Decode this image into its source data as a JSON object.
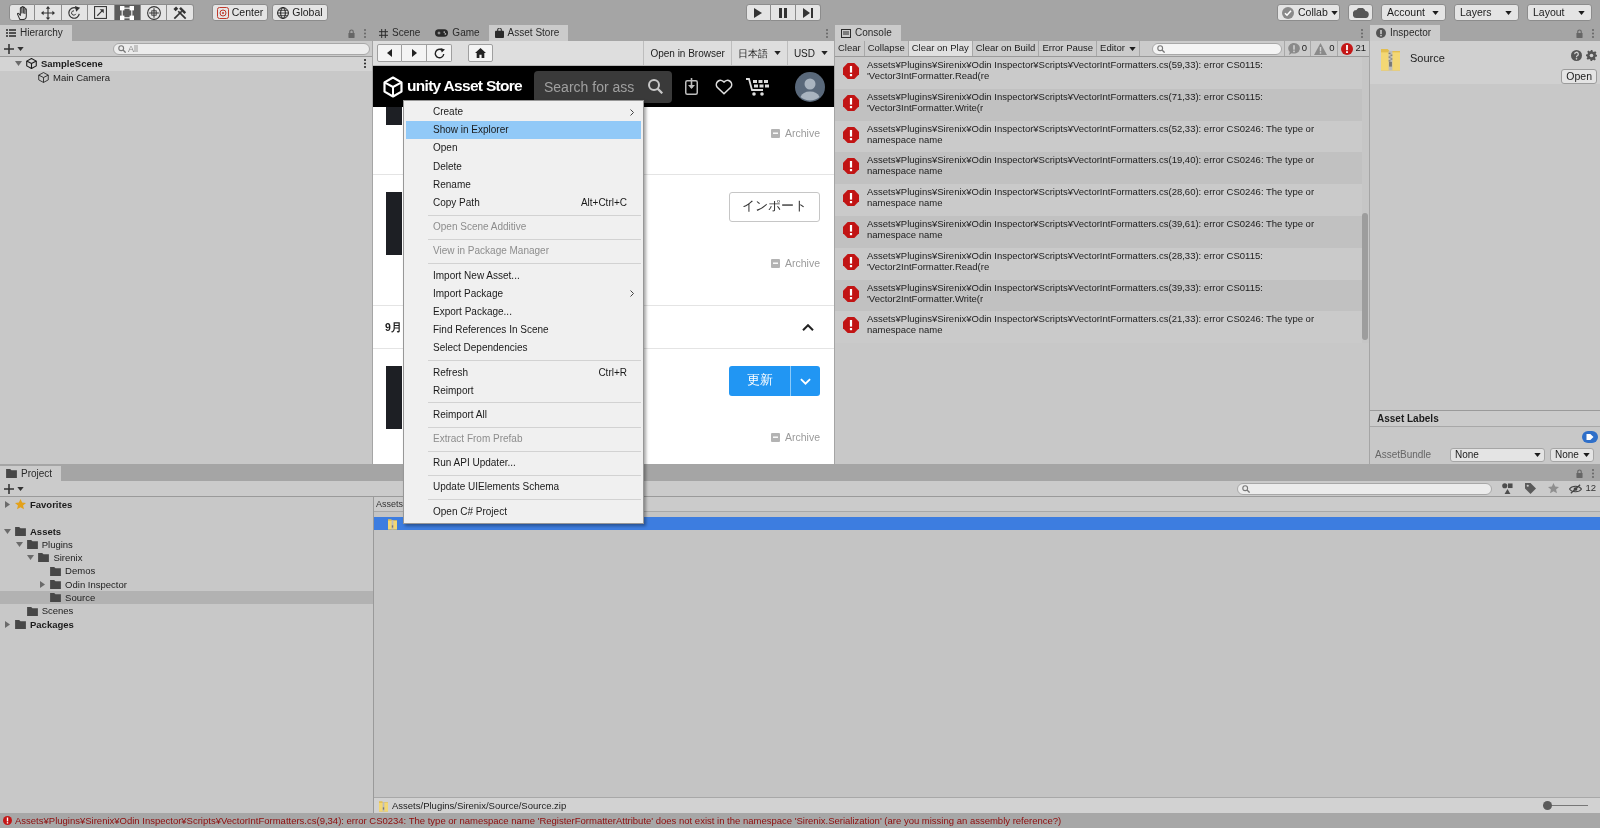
{
  "toolbar": {
    "tools": [
      {
        "selected": false
      },
      {
        "selected": false
      },
      {
        "selected": false
      },
      {
        "selected": false
      },
      {
        "selected": true
      },
      {
        "selected": false
      },
      {
        "selected": false
      }
    ],
    "pivot_buttons": [
      "Center",
      "Global"
    ],
    "collab": "Collab",
    "menus": [
      "Account",
      "Layers",
      "Layout"
    ]
  },
  "hierarchy": {
    "title": "Hierarchy",
    "search": {
      "placeholder": "All"
    },
    "items": [
      {
        "label": "SampleScene",
        "kind": "scene",
        "expanded": true,
        "selected": false,
        "children": [
          {
            "label": "Main Camera",
            "kind": "gameobject",
            "selected": false
          }
        ]
      }
    ]
  },
  "center_panel": {
    "tabs": [
      {
        "label": "Scene",
        "selected": false
      },
      {
        "label": "Game",
        "selected": false
      },
      {
        "label": "Asset Store",
        "selected": true
      }
    ],
    "browser": {
      "open_in_browser": "Open in Browser",
      "language": "日本語",
      "currency": "USD"
    },
    "store": {
      "logo": "unity Asset Store",
      "search": {
        "placeholder": "Search for ass"
      },
      "list": [
        {
          "kind": "item",
          "archive": "Archive"
        },
        {
          "kind": "item",
          "button": {
            "kind": "outline",
            "label": "インポート"
          },
          "archive": "Archive"
        },
        {
          "kind": "section",
          "title": "9月",
          "expanded": true
        },
        {
          "kind": "item",
          "button": {
            "kind": "split",
            "label": "更新"
          },
          "archive": "Archive"
        }
      ]
    }
  },
  "console": {
    "title": "Console",
    "buttons": [
      {
        "label": "Clear",
        "kind": "action"
      },
      {
        "label": "Collapse",
        "kind": "toggle",
        "on": false
      },
      {
        "label": "Clear on Play",
        "kind": "toggle",
        "on": true
      },
      {
        "label": "Clear on Build",
        "kind": "toggle",
        "on": false
      },
      {
        "label": "Error Pause",
        "kind": "toggle",
        "on": false
      }
    ],
    "editor_menu": "Editor",
    "counts": [
      {
        "kind": "info",
        "count": "0"
      },
      {
        "kind": "warning",
        "count": "0"
      },
      {
        "kind": "error",
        "count": "21"
      }
    ],
    "messages": [
      "Assets¥Plugins¥Sirenix¥Odin Inspector¥Scripts¥VectorIntFormatters.cs(59,33): error CS0115: 'Vector3IntFormatter.Read(re",
      "Assets¥Plugins¥Sirenix¥Odin Inspector¥Scripts¥VectorIntFormatters.cs(71,33): error CS0115: 'Vector3IntFormatter.Write(r",
      "Assets¥Plugins¥Sirenix¥Odin Inspector¥Scripts¥VectorIntFormatters.cs(52,33): error CS0246: The type or namespace name",
      "Assets¥Plugins¥Sirenix¥Odin Inspector¥Scripts¥VectorIntFormatters.cs(19,40): error CS0246: The type or namespace name",
      "Assets¥Plugins¥Sirenix¥Odin Inspector¥Scripts¥VectorIntFormatters.cs(28,60): error CS0246: The type or namespace name",
      "Assets¥Plugins¥Sirenix¥Odin Inspector¥Scripts¥VectorIntFormatters.cs(39,61): error CS0246: The type or namespace name",
      "Assets¥Plugins¥Sirenix¥Odin Inspector¥Scripts¥VectorIntFormatters.cs(28,33): error CS0115: 'Vector2IntFormatter.Read(re",
      "Assets¥Plugins¥Sirenix¥Odin Inspector¥Scripts¥VectorIntFormatters.cs(39,33): error CS0115: 'Vector2IntFormatter.Write(r",
      "Assets¥Plugins¥Sirenix¥Odin Inspector¥Scripts¥VectorIntFormatters.cs(21,33): error CS0246: The type or namespace name"
    ]
  },
  "inspector": {
    "title": "Inspector",
    "asset": {
      "name": "Source",
      "button": "Open"
    },
    "labels": {
      "title": "Asset Labels",
      "field": "AssetBundle",
      "bundle": "None",
      "variant": "None"
    }
  },
  "project": {
    "title": "Project",
    "tree": [
      {
        "label": "Favorites",
        "kind": "favorites",
        "expanded": false,
        "selected": false
      },
      {
        "label": "Assets",
        "kind": "folder",
        "expanded": true,
        "selected": false,
        "children": [
          {
            "label": "Plugins",
            "kind": "folder",
            "expanded": true,
            "selected": false,
            "children": [
              {
                "label": "Sirenix",
                "kind": "folder",
                "expanded": true,
                "selected": false,
                "children": [
                  {
                    "label": "Demos",
                    "kind": "folder",
                    "selected": false
                  },
                  {
                    "label": "Odin Inspector",
                    "kind": "folder",
                    "expanded": false,
                    "selected": false
                  },
                  {
                    "label": "Source",
                    "kind": "folder",
                    "selected": true
                  }
                ]
              }
            ]
          },
          {
            "label": "Scenes",
            "kind": "folder",
            "selected": false
          }
        ]
      },
      {
        "label": "Packages",
        "kind": "folder",
        "expanded": false,
        "selected": false
      }
    ],
    "breadcrumb": "Assets",
    "files": [
      {
        "selected": true
      }
    ],
    "hidden_count": "12",
    "path": "Assets/Plugins/Sirenix/Source/Source.zip",
    "zoom_slider": {
      "level": 0
    }
  },
  "context_menu": {
    "items": [
      {
        "kind": "item",
        "label": "Create",
        "submenu": true,
        "disabled": false,
        "selected": false
      },
      {
        "kind": "item",
        "label": "Show in Explorer",
        "submenu": false,
        "disabled": false,
        "selected": true
      },
      {
        "kind": "item",
        "label": "Open",
        "submenu": false,
        "disabled": false,
        "selected": false
      },
      {
        "kind": "item",
        "label": "Delete",
        "submenu": false,
        "disabled": false,
        "selected": false
      },
      {
        "kind": "item",
        "label": "Rename",
        "submenu": false,
        "disabled": false,
        "selected": false
      },
      {
        "kind": "item",
        "label": "Copy Path",
        "shortcut": "Alt+Ctrl+C",
        "submenu": false,
        "disabled": false,
        "selected": false
      },
      {
        "kind": "separator"
      },
      {
        "kind": "item",
        "label": "Open Scene Additive",
        "submenu": false,
        "disabled": true,
        "selected": false
      },
      {
        "kind": "separator"
      },
      {
        "kind": "item",
        "label": "View in Package Manager",
        "submenu": false,
        "disabled": true,
        "selected": false
      },
      {
        "kind": "separator"
      },
      {
        "kind": "item",
        "label": "Import New Asset...",
        "submenu": false,
        "disabled": false,
        "selected": false
      },
      {
        "kind": "item",
        "label": "Import Package",
        "submenu": true,
        "disabled": false,
        "selected": false
      },
      {
        "kind": "item",
        "label": "Export Package...",
        "submenu": false,
        "disabled": false,
        "selected": false
      },
      {
        "kind": "item",
        "label": "Find References In Scene",
        "submenu": false,
        "disabled": false,
        "selected": false
      },
      {
        "kind": "item",
        "label": "Select Dependencies",
        "submenu": false,
        "disabled": false,
        "selected": false
      },
      {
        "kind": "separator"
      },
      {
        "kind": "item",
        "label": "Refresh",
        "shortcut": "Ctrl+R",
        "submenu": false,
        "disabled": false,
        "selected": false
      },
      {
        "kind": "item",
        "label": "Reimport",
        "submenu": false,
        "disabled": false,
        "selected": false
      },
      {
        "kind": "separator"
      },
      {
        "kind": "item",
        "label": "Reimport All",
        "submenu": false,
        "disabled": false,
        "selected": false
      },
      {
        "kind": "separator"
      },
      {
        "kind": "item",
        "label": "Extract From Prefab",
        "submenu": false,
        "disabled": true,
        "selected": false
      },
      {
        "kind": "separator"
      },
      {
        "kind": "item",
        "label": "Run API Updater...",
        "submenu": false,
        "disabled": false,
        "selected": false
      },
      {
        "kind": "separator"
      },
      {
        "kind": "item",
        "label": "Update UIElements Schema",
        "submenu": false,
        "disabled": false,
        "selected": false
      },
      {
        "kind": "separator"
      },
      {
        "kind": "item",
        "label": "Open C# Project",
        "submenu": false,
        "disabled": false,
        "selected": false
      }
    ]
  },
  "status_bar": {
    "message": "Assets¥Plugins¥Sirenix¥Odin Inspector¥Scripts¥VectorIntFormatters.cs(9,34): error CS0234: The type or namespace name 'RegisterFormatterAttribute' does not exist in the namespace 'Sirenix.Serialization' (are you missing an assembly reference?)"
  }
}
